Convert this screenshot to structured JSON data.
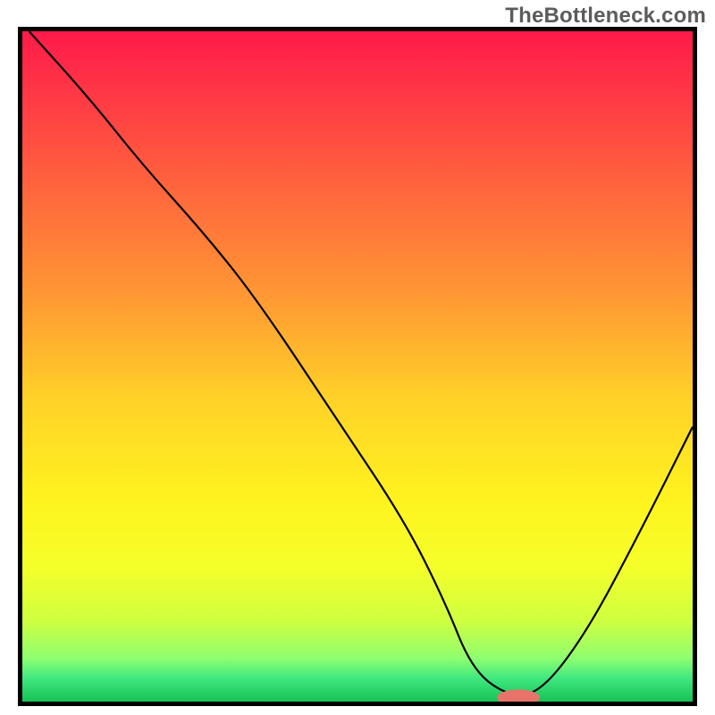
{
  "watermark": "TheBottleneck.com",
  "colors": {
    "border": "#000000",
    "curve": "#000000",
    "marker_fill": "#e8736a",
    "gradient_stops": [
      {
        "offset": 0.0,
        "color": "#ff1a4a"
      },
      {
        "offset": 0.1,
        "color": "#ff3a45"
      },
      {
        "offset": 0.25,
        "color": "#ff6a3c"
      },
      {
        "offset": 0.4,
        "color": "#ff9a33"
      },
      {
        "offset": 0.55,
        "color": "#ffd228"
      },
      {
        "offset": 0.7,
        "color": "#fff31f"
      },
      {
        "offset": 0.8,
        "color": "#f4ff2a"
      },
      {
        "offset": 0.88,
        "color": "#cfff40"
      },
      {
        "offset": 0.935,
        "color": "#8fff70"
      },
      {
        "offset": 0.965,
        "color": "#40e880"
      },
      {
        "offset": 1.0,
        "color": "#17c255"
      }
    ]
  },
  "chart_data": {
    "type": "line",
    "title": "",
    "xlabel": "",
    "ylabel": "",
    "xlim": [
      0,
      100
    ],
    "ylim": [
      0,
      100
    ],
    "series": [
      {
        "name": "bottleneck-curve",
        "x": [
          1,
          10,
          18,
          27,
          35,
          47,
          57,
          63,
          67,
          72,
          77,
          84,
          92,
          100
        ],
        "values": [
          100,
          90,
          80,
          70,
          60,
          42,
          27,
          15,
          5,
          1,
          1,
          10,
          25,
          41
        ]
      }
    ],
    "markers": [
      {
        "name": "optimal-marker",
        "x": 74,
        "y": 0.6,
        "rx": 3.2,
        "ry": 1.2
      }
    ],
    "grid": false,
    "legend": false
  }
}
